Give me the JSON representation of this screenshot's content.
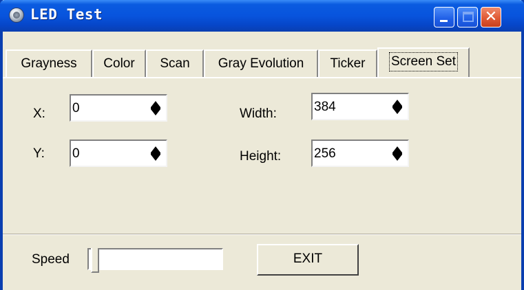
{
  "window": {
    "title": "LED Test"
  },
  "tabs": [
    "Grayness",
    "Color",
    "Scan",
    "Gray Evolution",
    "Ticker",
    "Screen Set"
  ],
  "active_tab": "Screen Set",
  "fields": {
    "x": {
      "label": "X:",
      "value": "0"
    },
    "y": {
      "label": "Y:",
      "value": "0"
    },
    "width": {
      "label": "Width:",
      "value": "384"
    },
    "height": {
      "label": "Height:",
      "value": "256"
    }
  },
  "speed": {
    "label": "Speed",
    "value": 0
  },
  "exit_button": {
    "label": "EXIT"
  },
  "icons": [
    "app-icon",
    "minimize-icon",
    "maximize-icon",
    "close-icon",
    "spin-up-icon",
    "spin-down-icon"
  ]
}
